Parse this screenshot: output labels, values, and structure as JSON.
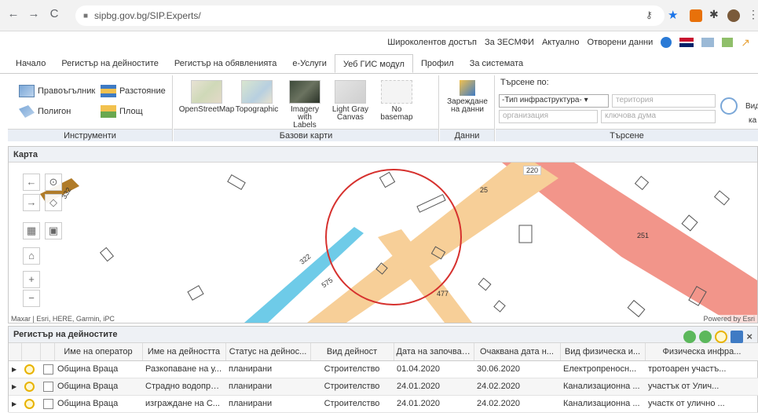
{
  "browser": {
    "url": "sipbg.gov.bg/SIP.Experts/"
  },
  "util_links": [
    "Широколентов достъп",
    "За ЗЕСМФИ",
    "Актуално",
    "Отворени данни"
  ],
  "nav_tabs": [
    {
      "label": "Начало"
    },
    {
      "label": "Регистър на дейностите"
    },
    {
      "label": "Регистър на обявленията"
    },
    {
      "label": "е-Услуги"
    },
    {
      "label": "Уеб ГИС модул",
      "active": true
    },
    {
      "label": "Профил"
    },
    {
      "label": "За системата"
    }
  ],
  "ribbon": {
    "tools": {
      "rectangle": "Правоъгълник",
      "distance": "Разстояние",
      "polygon": "Полигон",
      "area": "Площ",
      "caption": "Инструменти"
    },
    "basemaps": {
      "items": [
        "OpenStreetMap",
        "Topographic",
        "Imagery with Labels",
        "Light Gray Canvas",
        "No basemap"
      ],
      "caption": "Базови карти"
    },
    "data": {
      "load_label": "Зареждане на данни",
      "caption": "Данни"
    },
    "search": {
      "by_label": "Търсене по:",
      "type_select": "-Тип инфраструктура-",
      "territory_placeholder": "територия",
      "organization_placeholder": "организация",
      "keyword_placeholder": "ключова дума",
      "caption": "Търсене",
      "cut_label_top": "Вид",
      "cut_label_bottom": "ка"
    }
  },
  "map": {
    "title": "Карта",
    "attribution": "Maxar | Esri, HERE, Garmin, iPC",
    "powered": "Powered by Esri",
    "labels": [
      "220",
      "25",
      "251",
      "332",
      "322",
      "575",
      "477"
    ]
  },
  "grid": {
    "title": "Регистър на дейностите",
    "columns": [
      "Име на оператор",
      "Име на дейността",
      "Статус на дейнос...",
      "Вид дейност",
      "Дата на започване",
      "Очаквана дата н...",
      "Вид физическа и...",
      "Физическа инфра..."
    ],
    "rows": [
      [
        "Община Враца",
        "Разкопаване на у...",
        "планирани",
        "Строителство",
        "01.04.2020",
        "30.06.2020",
        "Електропреносн...",
        "тротоарен участъ..."
      ],
      [
        "Община Враца",
        "Страдно водопро...",
        "планирани",
        "Строителство",
        "24.01.2020",
        "24.02.2020",
        "Канализационна ...",
        "участък от Улич..."
      ],
      [
        "Община Враца",
        "изграждане на С...",
        "планирани",
        "Строителство",
        "24.01.2020",
        "24.02.2020",
        "Канализационна ...",
        "участк от улично ..."
      ]
    ]
  }
}
